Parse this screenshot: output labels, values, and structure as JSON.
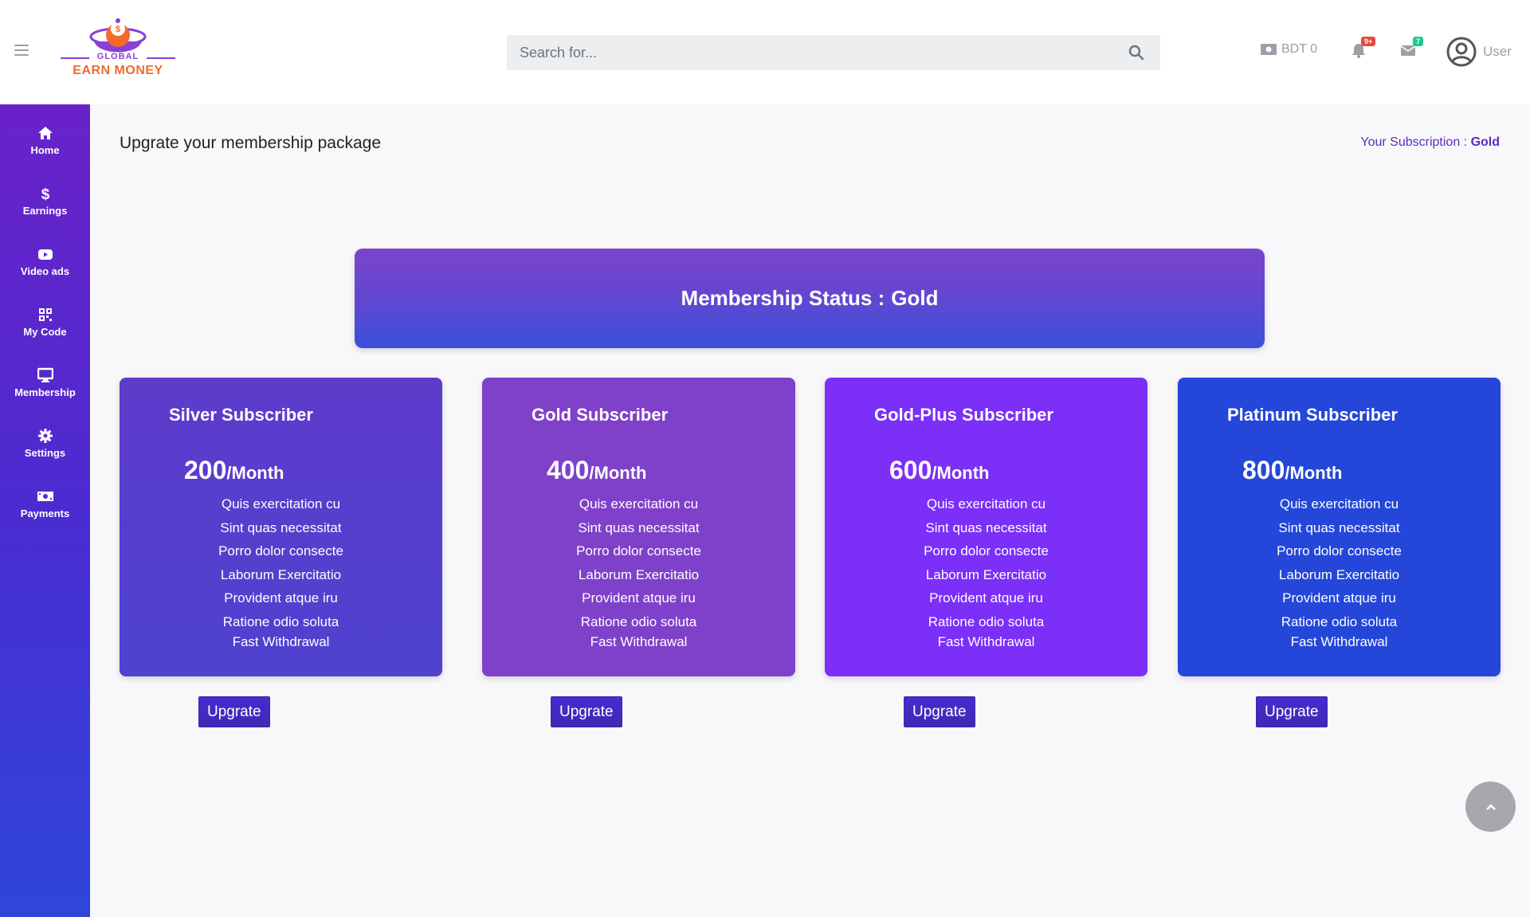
{
  "brand": {
    "logo_top": "GLOBAL",
    "logo_main": "EARN MONEY",
    "accent_purple": "#8b3fd6",
    "accent_orange": "#f26a2e"
  },
  "topbar": {
    "search_placeholder": "Search for...",
    "wallet_label": "BDT 0",
    "notifications_badge": "9+",
    "messages_badge": "7",
    "user_label": "User",
    "icons": [
      "bars-icon",
      "search-icon",
      "money-bill-icon",
      "bell-icon",
      "envelope-icon",
      "user-circle-icon"
    ]
  },
  "sidebar": {
    "items": [
      {
        "label": "Home",
        "icon": "home-icon"
      },
      {
        "label": "Earnings",
        "icon": "dollar-icon"
      },
      {
        "label": "Video ads",
        "icon": "youtube-icon"
      },
      {
        "label": "My Code",
        "icon": "qrcode-icon"
      },
      {
        "label": "Membership",
        "icon": "desktop-icon"
      },
      {
        "label": "Settings",
        "icon": "cog-icon"
      },
      {
        "label": "Payments",
        "icon": "money-bill-icon"
      }
    ]
  },
  "main": {
    "title": "Upgrate your membership package",
    "subscription_label": "Your Subscription : ",
    "subscription_value": "Gold",
    "status_label": "Membership Status : ",
    "status_value": "Gold",
    "plans": [
      {
        "title": "Silver Subscriber",
        "price": "200",
        "period": "/Month",
        "color": "#5b3dcb",
        "features": [
          "Quis exercitation cu",
          "Sint quas necessitat",
          "Porro dolor consecte",
          "Laborum Exercitatio",
          "Provident atque iru",
          "Ratione odio soluta",
          "Fast Withdrawal"
        ],
        "button": "Upgrate"
      },
      {
        "title": "Gold Subscriber",
        "price": "400",
        "period": "/Month",
        "color": "#7f41c9",
        "features": [
          "Quis exercitation cu",
          "Sint quas necessitat",
          "Porro dolor consecte",
          "Laborum Exercitatio",
          "Provident atque iru",
          "Ratione odio soluta",
          "Fast Withdrawal"
        ],
        "button": "Upgrate"
      },
      {
        "title": "Gold-Plus Subscriber",
        "price": "600",
        "period": "/Month",
        "color": "#7b2ff7",
        "features": [
          "Quis exercitation cu",
          "Sint quas necessitat",
          "Porro dolor consecte",
          "Laborum Exercitatio",
          "Provident atque iru",
          "Ratione odio soluta",
          "Fast Withdrawal"
        ],
        "button": "Upgrate"
      },
      {
        "title": "Platinum Subscriber",
        "price": "800",
        "period": "/Month",
        "color": "#2447d9",
        "features": [
          "Quis exercitation cu",
          "Sint quas necessitat",
          "Porro dolor consecte",
          "Laborum Exercitatio",
          "Provident atque iru",
          "Ratione odio soluta",
          "Fast Withdrawal"
        ],
        "button": "Upgrate"
      }
    ]
  }
}
